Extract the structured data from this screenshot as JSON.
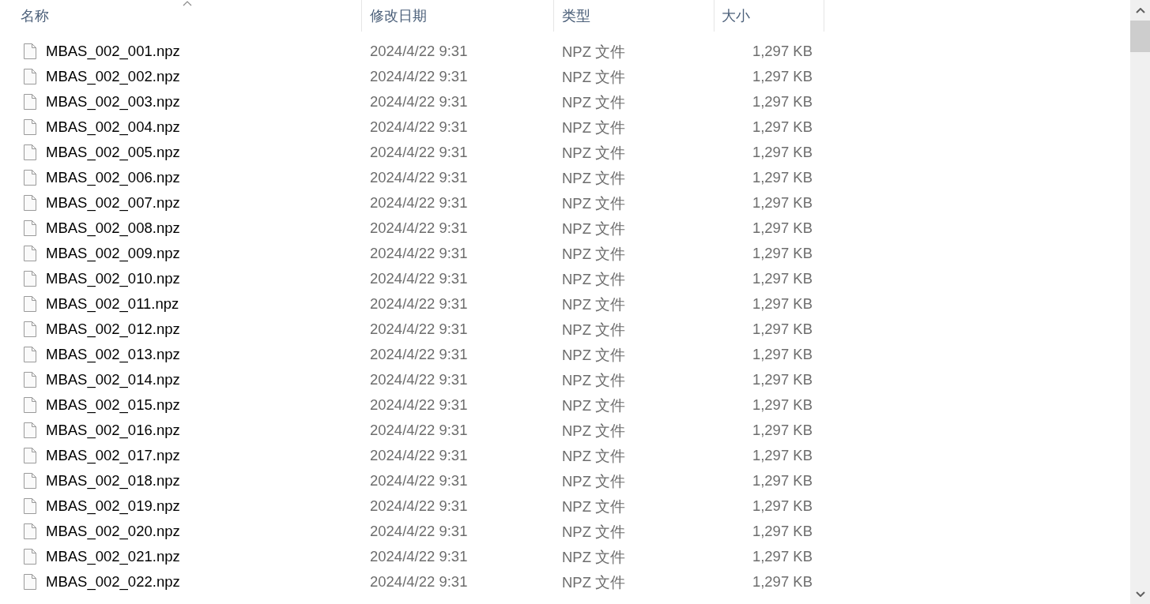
{
  "table": {
    "columns": [
      {
        "label": "名称",
        "sorted": true
      },
      {
        "label": "修改日期",
        "sorted": false
      },
      {
        "label": "类型",
        "sorted": false
      },
      {
        "label": "大小",
        "sorted": false
      }
    ],
    "rows": [
      {
        "name": "MBAS_002_001.npz",
        "modified": "2024/4/22 9:31",
        "type": "NPZ 文件",
        "size": "1,297 KB"
      },
      {
        "name": "MBAS_002_002.npz",
        "modified": "2024/4/22 9:31",
        "type": "NPZ 文件",
        "size": "1,297 KB"
      },
      {
        "name": "MBAS_002_003.npz",
        "modified": "2024/4/22 9:31",
        "type": "NPZ 文件",
        "size": "1,297 KB"
      },
      {
        "name": "MBAS_002_004.npz",
        "modified": "2024/4/22 9:31",
        "type": "NPZ 文件",
        "size": "1,297 KB"
      },
      {
        "name": "MBAS_002_005.npz",
        "modified": "2024/4/22 9:31",
        "type": "NPZ 文件",
        "size": "1,297 KB"
      },
      {
        "name": "MBAS_002_006.npz",
        "modified": "2024/4/22 9:31",
        "type": "NPZ 文件",
        "size": "1,297 KB"
      },
      {
        "name": "MBAS_002_007.npz",
        "modified": "2024/4/22 9:31",
        "type": "NPZ 文件",
        "size": "1,297 KB"
      },
      {
        "name": "MBAS_002_008.npz",
        "modified": "2024/4/22 9:31",
        "type": "NPZ 文件",
        "size": "1,297 KB"
      },
      {
        "name": "MBAS_002_009.npz",
        "modified": "2024/4/22 9:31",
        "type": "NPZ 文件",
        "size": "1,297 KB"
      },
      {
        "name": "MBAS_002_010.npz",
        "modified": "2024/4/22 9:31",
        "type": "NPZ 文件",
        "size": "1,297 KB"
      },
      {
        "name": "MBAS_002_011.npz",
        "modified": "2024/4/22 9:31",
        "type": "NPZ 文件",
        "size": "1,297 KB"
      },
      {
        "name": "MBAS_002_012.npz",
        "modified": "2024/4/22 9:31",
        "type": "NPZ 文件",
        "size": "1,297 KB"
      },
      {
        "name": "MBAS_002_013.npz",
        "modified": "2024/4/22 9:31",
        "type": "NPZ 文件",
        "size": "1,297 KB"
      },
      {
        "name": "MBAS_002_014.npz",
        "modified": "2024/4/22 9:31",
        "type": "NPZ 文件",
        "size": "1,297 KB"
      },
      {
        "name": "MBAS_002_015.npz",
        "modified": "2024/4/22 9:31",
        "type": "NPZ 文件",
        "size": "1,297 KB"
      },
      {
        "name": "MBAS_002_016.npz",
        "modified": "2024/4/22 9:31",
        "type": "NPZ 文件",
        "size": "1,297 KB"
      },
      {
        "name": "MBAS_002_017.npz",
        "modified": "2024/4/22 9:31",
        "type": "NPZ 文件",
        "size": "1,297 KB"
      },
      {
        "name": "MBAS_002_018.npz",
        "modified": "2024/4/22 9:31",
        "type": "NPZ 文件",
        "size": "1,297 KB"
      },
      {
        "name": "MBAS_002_019.npz",
        "modified": "2024/4/22 9:31",
        "type": "NPZ 文件",
        "size": "1,297 KB"
      },
      {
        "name": "MBAS_002_020.npz",
        "modified": "2024/4/22 9:31",
        "type": "NPZ 文件",
        "size": "1,297 KB"
      },
      {
        "name": "MBAS_002_021.npz",
        "modified": "2024/4/22 9:31",
        "type": "NPZ 文件",
        "size": "1,297 KB"
      },
      {
        "name": "MBAS_002_022.npz",
        "modified": "2024/4/22 9:31",
        "type": "NPZ 文件",
        "size": "1,297 KB"
      }
    ]
  }
}
